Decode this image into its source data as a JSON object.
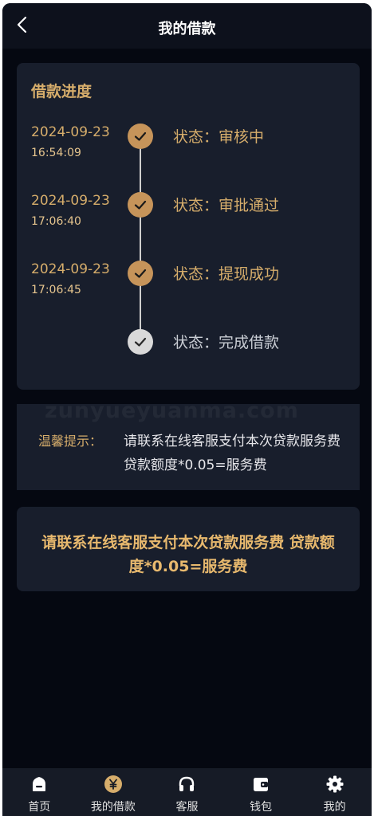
{
  "header": {
    "title": "我的借款"
  },
  "progress": {
    "title": "借款进度",
    "steps": [
      {
        "date": "2024-09-23",
        "time": "16:54:09",
        "status": "状态：审核中",
        "done": true
      },
      {
        "date": "2024-09-23",
        "time": "17:06:40",
        "status": "状态：审批通过",
        "done": true
      },
      {
        "date": "2024-09-23",
        "time": "17:06:45",
        "status": "状态：提现成功",
        "done": true
      },
      {
        "date": "",
        "time": "",
        "status": "状态：完成借款",
        "done": false
      }
    ]
  },
  "notice": {
    "watermark": "zunyueyuanma.com",
    "label": "温馨提示：",
    "text": "请联系在线客服支付本次贷款服务费 贷款额度*0.05=服务费"
  },
  "highlight": {
    "text": "请联系在线客服支付本次贷款服务费 贷款额度*0.05=服务费"
  },
  "tabbar": {
    "items": [
      {
        "label": "首页",
        "icon": "home-icon"
      },
      {
        "label": "我的借款",
        "icon": "yen-icon"
      },
      {
        "label": "客服",
        "icon": "headset-icon"
      },
      {
        "label": "钱包",
        "icon": "wallet-icon"
      },
      {
        "label": "我的",
        "icon": "gear-icon"
      }
    ],
    "active_index": 1
  },
  "colors": {
    "background": "#050811",
    "card": "#181e2c",
    "gold": "#d6ad6b",
    "step_done": "#c6945a",
    "step_pending": "#d9d9d9"
  }
}
